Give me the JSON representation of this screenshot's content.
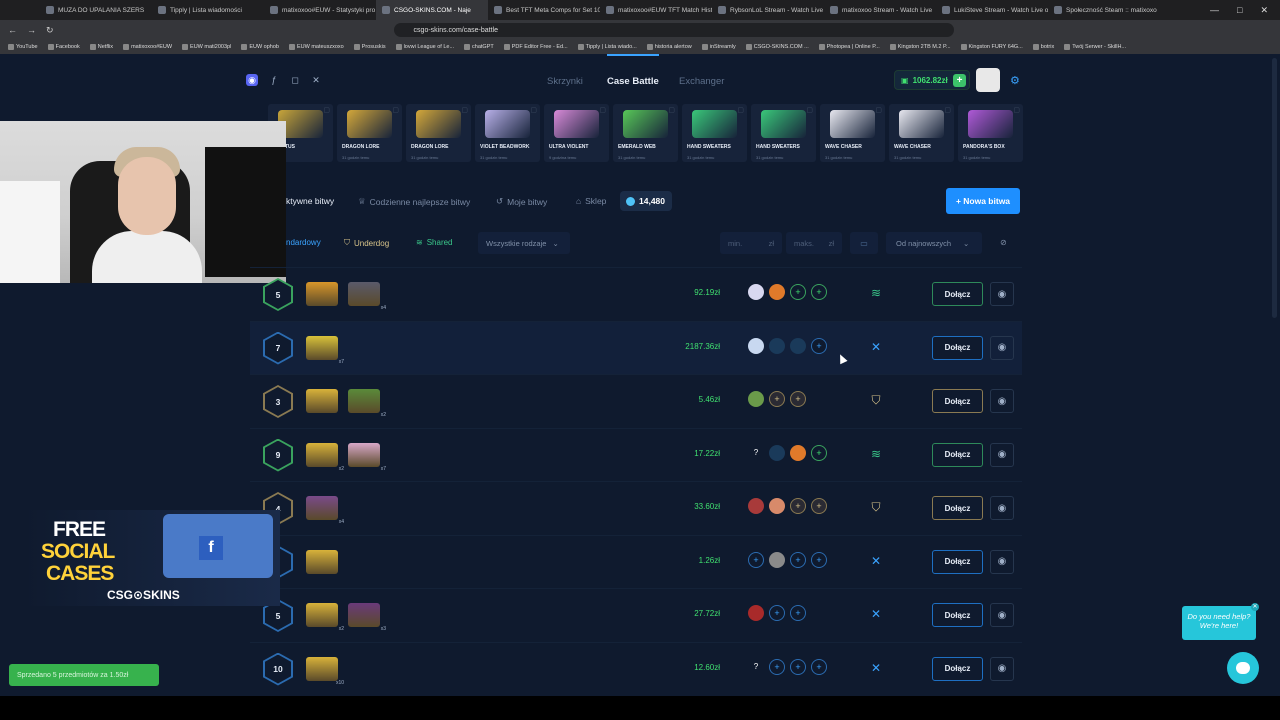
{
  "browser": {
    "tabs": [
      {
        "label": "MUZA DO UPALANIA SZERS"
      },
      {
        "label": "Tipply | Lista wiadomości"
      },
      {
        "label": "matixoxoo#EUW - Statystyki pro"
      },
      {
        "label": "CSGO-SKINS.COM - Naje",
        "active": true
      },
      {
        "label": "Best TFT Meta Comps for Set 10"
      },
      {
        "label": "matixoxoo#EUW TFT Match Hist"
      },
      {
        "label": "RybsonLoL Stream - Watch Live"
      },
      {
        "label": "matixoxoo Stream - Watch Live"
      },
      {
        "label": "LukiSteve Stream - Watch Live or"
      },
      {
        "label": "Społeczność Steam :: matixoxo"
      }
    ],
    "url": "csgo-skins.com/case-battle",
    "bookmarks": [
      "YouTube",
      "Facebook",
      "Netflix",
      "matixoxoo#EUW",
      "EUW mati2003pl",
      "EUW ophob",
      "EUW mateuszxoxo",
      "Prosuskis",
      "lovwi League of Le...",
      "chatGPT",
      "PDF Editor Free - Ed...",
      "Tipply | Lista wiado...",
      "historia alertow",
      "inStreamly",
      "CSGO-SKINS.COM ...",
      "Photopea | Online P...",
      "Kingston 2TB M.2 P...",
      "Kingston FURY 64G...",
      "botrix",
      "Twój Serwer - SkillH..."
    ]
  },
  "nav": {
    "links": [
      "Skrzynki",
      "Case Battle",
      "Exchanger"
    ],
    "active": "Case Battle",
    "balance": "1062.82zł",
    "balance_plus": "+",
    "gear_icon": "⚙"
  },
  "drops": [
    {
      "name": "D LOTUS",
      "sub": "",
      "color": "#c9a63a"
    },
    {
      "name": "DRAGON LORE",
      "sub": "31 godzin temu",
      "color": "#d4a83a"
    },
    {
      "name": "DRAGON LORE",
      "sub": "31 godzin temu",
      "color": "#d4a83a"
    },
    {
      "name": "VIOLET BEADWORK",
      "sub": "31 godzin temu",
      "color": "#b8b0e8"
    },
    {
      "name": "ULTRA VIOLENT",
      "sub": "9 godzina temu",
      "color": "#d88ad8"
    },
    {
      "name": "EMERALD WEB",
      "sub": "31 godzin temu",
      "color": "#58c858"
    },
    {
      "name": "HAND SWEATERS",
      "sub": "31 godzin temu",
      "color": "#3ac87a"
    },
    {
      "name": "HAND SWEATERS",
      "sub": "31 godzin temu",
      "color": "#3ac87a"
    },
    {
      "name": "WAVE CHASER",
      "sub": "31 godzin temu",
      "color": "#e8e8f0"
    },
    {
      "name": "WAVE CHASER",
      "sub": "31 godzin temu",
      "color": "#e8e8f0"
    },
    {
      "name": "PANDORA'S BOX",
      "sub": "31 godzin temu",
      "color": "#b05ad8"
    }
  ],
  "tabs": {
    "items": [
      "ktywne bitwy",
      "Codzienne najlepsze bitwy",
      "Moje bitwy",
      "Sklep"
    ],
    "coins": "14,480",
    "new_battle": "+ Nowa bitwa"
  },
  "filters": {
    "modes": [
      "ndardowy",
      "Underdog",
      "Shared"
    ],
    "type_select": "Wszystkie rodzaje",
    "min_placeholder": "min.",
    "max_placeholder": "maks.",
    "currency": "zł",
    "sort": "Od najnowszych"
  },
  "battles": [
    {
      "rounds": "5",
      "ring": "#3aa35e",
      "cases": [
        {
          "c": "#d8962a",
          "m": ""
        },
        {
          "c": "#5a5a6a",
          "m": "x4"
        }
      ],
      "price": "92.19zł",
      "players": [
        "av:#d8d8f0",
        "av:#e07a2a",
        "empty-green",
        "empty-green"
      ],
      "mode": "≋",
      "modeColor": "#3ac88a",
      "join": "Dołącz",
      "style": "green"
    },
    {
      "rounds": "7",
      "ring": "#2b6bb0",
      "cases": [
        {
          "c": "#d8c23a",
          "m": "x7"
        }
      ],
      "price": "2187.36zł",
      "players": [
        "av:#c8d8f0",
        "av:#1a3a5a",
        "av:#1a3a5a",
        "empty-blue"
      ],
      "mode": "✕",
      "modeColor": "#3aa3ff",
      "join": "Dołącz",
      "style": "blue",
      "hover": true
    },
    {
      "rounds": "3",
      "ring": "#8a7a52",
      "cases": [
        {
          "c": "#d8b23a",
          "m": ""
        },
        {
          "c": "#5a8a3a",
          "m": "x2"
        }
      ],
      "price": "5.46zł",
      "players": [
        "av:#6a9a4a",
        "empty-gold",
        "empty-gold"
      ],
      "mode": "⛉",
      "modeColor": "#d8c48a",
      "join": "Dołącz",
      "style": "gold"
    },
    {
      "rounds": "9",
      "ring": "#3aa35e",
      "cases": [
        {
          "c": "#d8b23a",
          "m": "x2"
        },
        {
          "c": "#d8a8c8",
          "m": "x7"
        }
      ],
      "price": "17.22zł",
      "players": [
        "q:?",
        "av:#1a3a5a",
        "av:#e07a2a",
        "empty-green"
      ],
      "mode": "≋",
      "modeColor": "#3ac88a",
      "join": "Dołącz",
      "style": "green"
    },
    {
      "rounds": "4",
      "ring": "#8a7a52",
      "cases": [
        {
          "c": "#7a4a8a",
          "m": "x4"
        }
      ],
      "price": "33.60zł",
      "players": [
        "av:#a83a3a",
        "av:#d88a6a",
        "empty-gold",
        "empty-gold"
      ],
      "mode": "⛉",
      "modeColor": "#d8c48a",
      "join": "Dołącz",
      "style": "gold"
    },
    {
      "rounds": "",
      "ring": "#2b6bb0",
      "cases": [
        {
          "c": "#d8b23a",
          "m": ""
        }
      ],
      "price": "1.26zł",
      "players": [
        "empty-blue",
        "av:#8a8a8a",
        "empty-blue",
        "empty-blue"
      ],
      "mode": "✕",
      "modeColor": "#3aa3ff",
      "join": "Dołącz",
      "style": "blue"
    },
    {
      "rounds": "5",
      "ring": "#2b6bb0",
      "cases": [
        {
          "c": "#d8b23a",
          "m": "x2"
        },
        {
          "c": "#6a3a7a",
          "m": "x3"
        }
      ],
      "price": "27.72zł",
      "players": [
        "av:#a82a2a",
        "empty-blue",
        "empty-blue"
      ],
      "mode": "✕",
      "modeColor": "#3aa3ff",
      "join": "Dołącz",
      "style": "blue"
    },
    {
      "rounds": "10",
      "ring": "#2b6bb0",
      "cases": [
        {
          "c": "#d8b23a",
          "m": "x10"
        }
      ],
      "price": "12.60zł",
      "players": [
        "q:?",
        "empty-blue",
        "empty-blue",
        "empty-blue"
      ],
      "mode": "✕",
      "modeColor": "#3aa3ff",
      "join": "Dołącz",
      "style": "blue"
    }
  ],
  "promo": {
    "line1": "FREE",
    "line2": "SOCIAL",
    "line3": "CASES",
    "brand": "CSG⊙SKINS"
  },
  "toast": "Sprzedano 5 przedmiotów za 1.50zł",
  "help": {
    "line1": "Do you need help?",
    "line2": "We're here!"
  }
}
